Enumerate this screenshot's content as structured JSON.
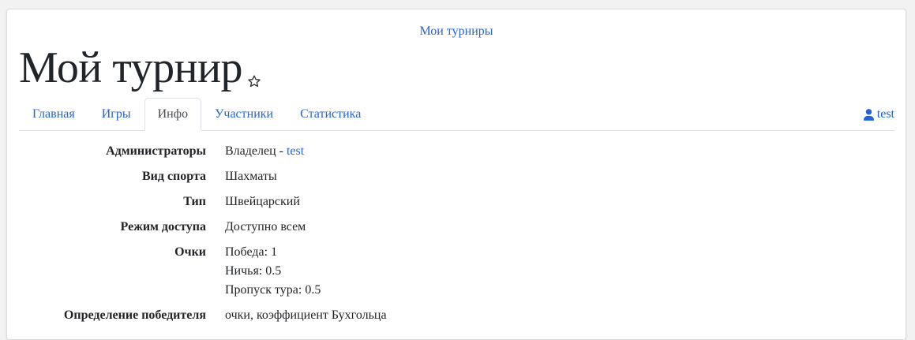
{
  "header": {
    "top_link": "Мои турниры",
    "title": "Мой турнир"
  },
  "tabs": [
    {
      "label": "Главная",
      "active": false
    },
    {
      "label": "Игры",
      "active": false
    },
    {
      "label": "Инфо",
      "active": true
    },
    {
      "label": "Участники",
      "active": false
    },
    {
      "label": "Статистика",
      "active": false
    }
  ],
  "user": {
    "name": "test",
    "icon": "user-icon"
  },
  "info": {
    "admins": {
      "label": "Администраторы",
      "prefix": "Владелец - ",
      "owner": "test"
    },
    "sport": {
      "label": "Вид спорта",
      "value": "Шахматы"
    },
    "type": {
      "label": "Тип",
      "value": "Швейцарский"
    },
    "access": {
      "label": "Режим доступа",
      "value": "Доступно всем"
    },
    "points": {
      "label": "Очки",
      "win": "Победа: 1",
      "draw": "Ничья: 0.5",
      "bye": "Пропуск тура: 0.5"
    },
    "winner": {
      "label": "Определение победителя",
      "value": "очки, коэффициент Бухгольца"
    }
  },
  "colors": {
    "link": "#2563d9",
    "text": "#212529",
    "border": "#dee2e6"
  }
}
